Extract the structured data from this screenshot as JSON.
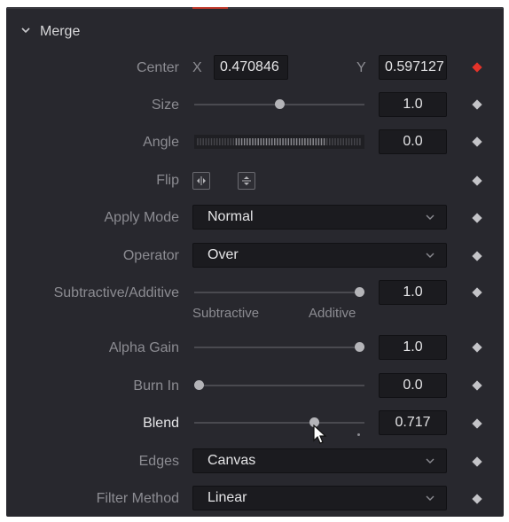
{
  "section": {
    "title": "Merge"
  },
  "center": {
    "label": "Center",
    "x_label": "X",
    "x_value": "0.470846",
    "y_label": "Y",
    "y_value": "0.597127"
  },
  "size": {
    "label": "Size",
    "value": "1.0",
    "slider_fraction": 0.5
  },
  "angle": {
    "label": "Angle",
    "value": "0.0"
  },
  "flip": {
    "label": "Flip",
    "horizontal_icon": "flip-horizontal-icon",
    "vertical_icon": "flip-vertical-icon"
  },
  "apply_mode": {
    "label": "Apply Mode",
    "value": "Normal"
  },
  "operator": {
    "label": "Operator",
    "value": "Over"
  },
  "subtractive_additive": {
    "label": "Subtractive/Additive",
    "value": "1.0",
    "slider_fraction": 1.0,
    "left_caption": "Subtractive",
    "right_caption": "Additive"
  },
  "alpha_gain": {
    "label": "Alpha Gain",
    "value": "1.0",
    "slider_fraction": 1.0
  },
  "burn_in": {
    "label": "Burn In",
    "value": "0.0",
    "slider_fraction": 0.0
  },
  "blend": {
    "label": "Blend",
    "value": "0.717",
    "slider_fraction": 0.717
  },
  "edges": {
    "label": "Edges",
    "value": "Canvas"
  },
  "filter_method": {
    "label": "Filter Method",
    "value": "Linear"
  },
  "colors": {
    "panel_bg": "#28282e",
    "keyframe_active": "#e5332a",
    "keyframe": "#c4c4c8"
  }
}
